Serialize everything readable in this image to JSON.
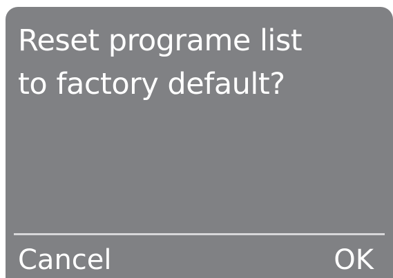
{
  "dialog": {
    "message_lines": [
      "Reset programe list",
      "to factory default?"
    ],
    "cancel_label": "Cancel",
    "ok_label": "OK"
  },
  "colors": {
    "dialog_background": "#808184",
    "divider": "#d8d8da",
    "text": "#ffffff"
  }
}
